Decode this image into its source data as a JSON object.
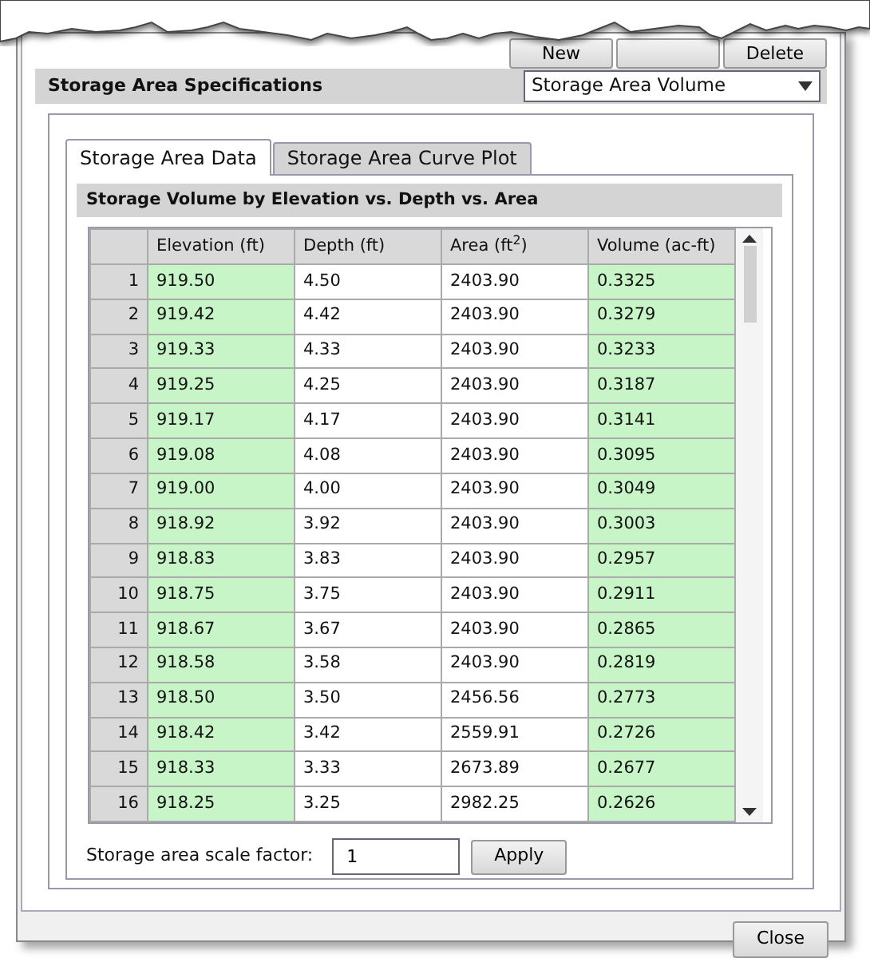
{
  "top_buttons": [
    {
      "kind": "labeled",
      "label": "New"
    },
    {
      "kind": "blank"
    },
    {
      "kind": "labeled",
      "label": "Delete"
    }
  ],
  "specifications": {
    "title": "Storage Area Specifications",
    "dropdown_value": "Storage Area Volume"
  },
  "tabs": [
    {
      "label": "Storage Area Data",
      "selected": true
    },
    {
      "label": "Storage Area Curve Plot",
      "selected": false
    }
  ],
  "table_title": "Storage Volume by Elevation vs. Depth vs. Area",
  "table": {
    "columns": [
      {
        "label": "Elevation (ft)",
        "highlighted": true
      },
      {
        "label": "Depth (ft)",
        "highlighted": false
      },
      {
        "label": "Area (ft$^{2}$)",
        "highlighted": false
      },
      {
        "label": "Volume (ac-ft)",
        "highlighted": true
      }
    ],
    "rows": [
      {
        "number": "1",
        "cells": [
          "919.50",
          "4.50",
          "2403.90",
          "0.3325"
        ]
      },
      {
        "number": "2",
        "cells": [
          "919.42",
          "4.42",
          "2403.90",
          "0.3279"
        ]
      },
      {
        "number": "3",
        "cells": [
          "919.33",
          "4.33",
          "2403.90",
          "0.3233"
        ]
      },
      {
        "number": "4",
        "cells": [
          "919.25",
          "4.25",
          "2403.90",
          "0.3187"
        ]
      },
      {
        "number": "5",
        "cells": [
          "919.17",
          "4.17",
          "2403.90",
          "0.3141"
        ]
      },
      {
        "number": "6",
        "cells": [
          "919.08",
          "4.08",
          "2403.90",
          "0.3095"
        ]
      },
      {
        "number": "7",
        "cells": [
          "919.00",
          "4.00",
          "2403.90",
          "0.3049"
        ]
      },
      {
        "number": "8",
        "cells": [
          "918.92",
          "3.92",
          "2403.90",
          "0.3003"
        ]
      },
      {
        "number": "9",
        "cells": [
          "918.83",
          "3.83",
          "2403.90",
          "0.2957"
        ]
      },
      {
        "number": "10",
        "cells": [
          "918.75",
          "3.75",
          "2403.90",
          "0.2911"
        ]
      },
      {
        "number": "11",
        "cells": [
          "918.67",
          "3.67",
          "2403.90",
          "0.2865"
        ]
      },
      {
        "number": "12",
        "cells": [
          "918.58",
          "3.58",
          "2403.90",
          "0.2819"
        ]
      },
      {
        "number": "13",
        "cells": [
          "918.50",
          "3.50",
          "2456.56",
          "0.2773"
        ]
      },
      {
        "number": "14",
        "cells": [
          "918.42",
          "3.42",
          "2559.91",
          "0.2726"
        ]
      },
      {
        "number": "15",
        "cells": [
          "918.33",
          "3.33",
          "2673.89",
          "0.2677"
        ]
      },
      {
        "number": "16",
        "cells": [
          "918.25",
          "3.25",
          "2982.25",
          "0.2626"
        ]
      }
    ]
  },
  "scale_factor": {
    "label": "Storage area scale factor:",
    "value": "1",
    "button": "Apply"
  },
  "footer_buttons": [
    "Close"
  ]
}
